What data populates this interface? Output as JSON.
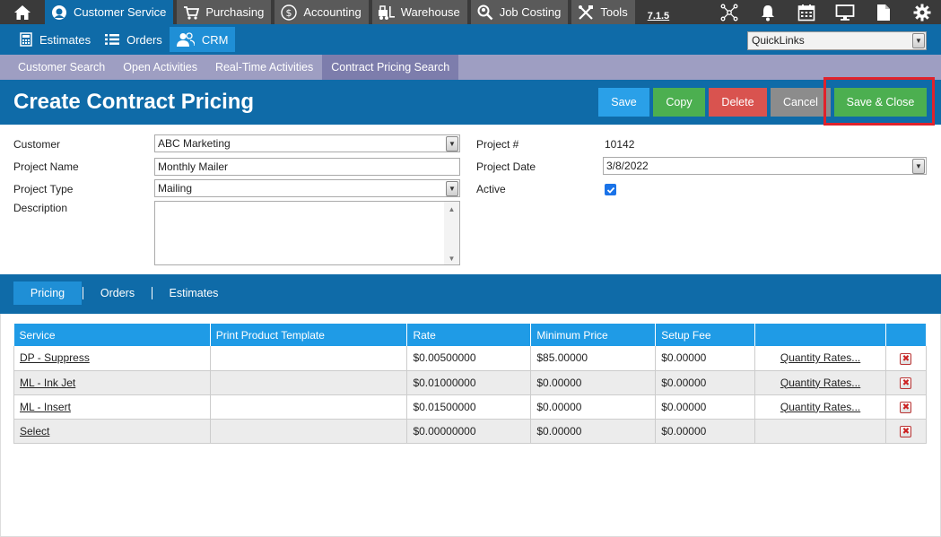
{
  "topnav": {
    "items": [
      {
        "label": "Customer Service",
        "icon": "customer-service-icon",
        "active": true
      },
      {
        "label": "Purchasing",
        "icon": "cart-icon",
        "active": false
      },
      {
        "label": "Accounting",
        "icon": "dollar-icon",
        "active": false
      },
      {
        "label": "Warehouse",
        "icon": "forklift-icon",
        "active": false
      },
      {
        "label": "Job Costing",
        "icon": "magnifier-person-icon",
        "active": false
      },
      {
        "label": "Tools",
        "icon": "tools-icon",
        "active": false
      }
    ],
    "version": "7.1.5",
    "right_icons": [
      "network-icon",
      "bell-icon",
      "calendar-icon",
      "monitor-icon",
      "document-icon",
      "gear-icon"
    ]
  },
  "subnav": {
    "items": [
      {
        "label": "Estimates",
        "icon": "calculator-icon"
      },
      {
        "label": "Orders",
        "icon": "list-icon"
      },
      {
        "label": "CRM",
        "icon": "users-icon",
        "active": true
      }
    ],
    "quicklinks": "QuickLinks"
  },
  "tabnav": {
    "items": [
      "Customer Search",
      "Open Activities",
      "Real-Time Activities",
      "Contract Pricing Search"
    ]
  },
  "page": {
    "title": "Create Contract Pricing",
    "buttons": {
      "save": "Save",
      "copy": "Copy",
      "delete": "Delete",
      "cancel": "Cancel",
      "save_close": "Save & Close"
    }
  },
  "form": {
    "customer_label": "Customer",
    "customer_value": "ABC Marketing",
    "project_name_label": "Project Name",
    "project_name_value": "Monthly Mailer",
    "project_type_label": "Project Type",
    "project_type_value": "Mailing",
    "description_label": "Description",
    "project_num_label": "Project #",
    "project_num_value": "10142",
    "project_date_label": "Project Date",
    "project_date_value": "3/8/2022",
    "active_label": "Active",
    "active_checked": true
  },
  "subtabs": [
    "Pricing",
    "Orders",
    "Estimates"
  ],
  "table": {
    "headers": [
      "Service",
      "Print Product Template",
      "Rate",
      "Minimum Price",
      "Setup Fee",
      "",
      ""
    ],
    "rows": [
      {
        "service": "DP - Suppress",
        "template": "",
        "rate": "$0.00500000",
        "min": "$85.00000",
        "setup": "$0.00000",
        "qty": "Quantity Rates..."
      },
      {
        "service": "ML - Ink Jet",
        "template": "",
        "rate": "$0.01000000",
        "min": "$0.00000",
        "setup": "$0.00000",
        "qty": "Quantity Rates..."
      },
      {
        "service": "ML - Insert",
        "template": "",
        "rate": "$0.01500000",
        "min": "$0.00000",
        "setup": "$0.00000",
        "qty": "Quantity Rates..."
      },
      {
        "service": "Select",
        "template": "",
        "rate": "$0.00000000",
        "min": "$0.00000",
        "setup": "$0.00000",
        "qty": ""
      }
    ]
  }
}
